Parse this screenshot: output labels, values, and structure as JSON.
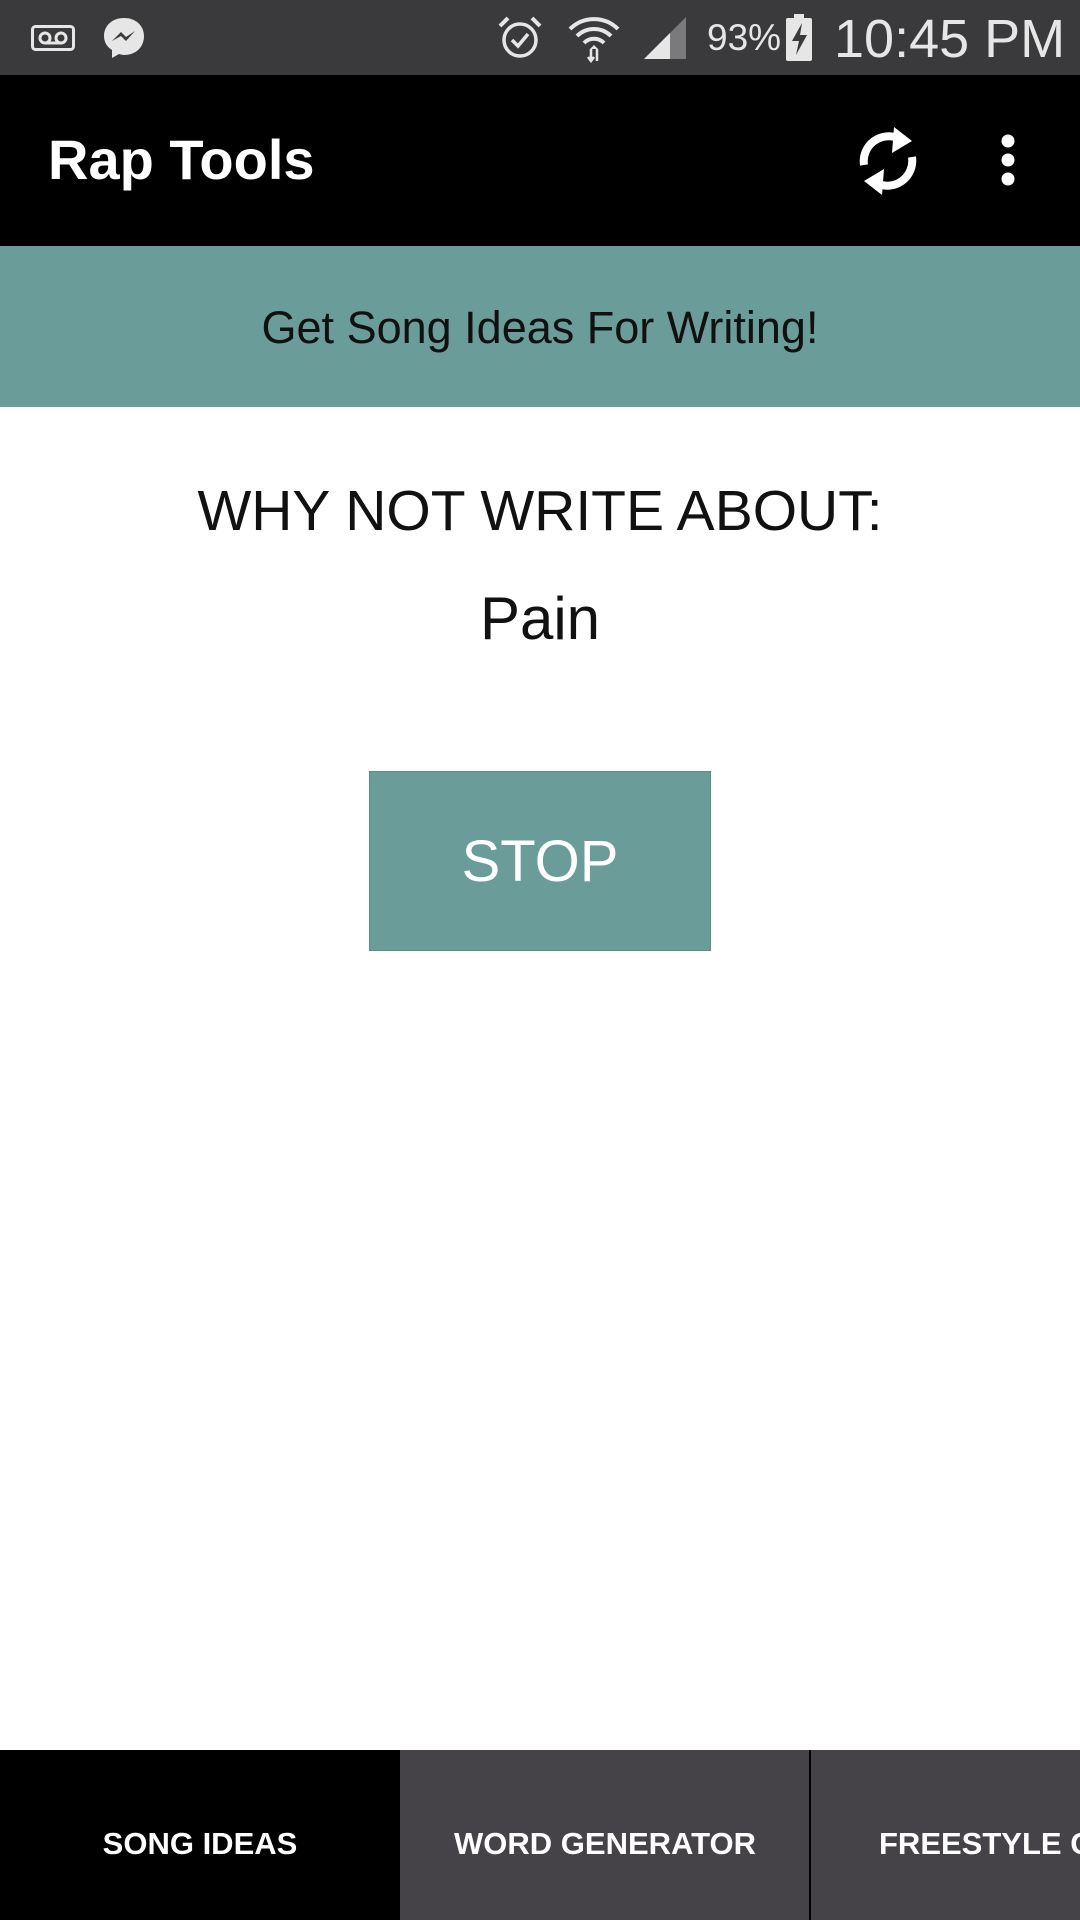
{
  "status_bar": {
    "battery_percent": "93%",
    "clock": "10:45 PM",
    "icons": [
      "voicemail-icon",
      "messenger-icon",
      "alarm-icon",
      "wifi-icon",
      "signal-icon",
      "battery-charging-icon"
    ]
  },
  "app_bar": {
    "title": "Rap Tools",
    "refresh_icon": "refresh-icon",
    "overflow_icon": "more-vertical-icon"
  },
  "banner": {
    "text": "Get Song Ideas For Writing!"
  },
  "content": {
    "heading": "WHY NOT WRITE ABOUT:",
    "idea": "Pain",
    "stop_label": "STOP"
  },
  "tabs": [
    {
      "label": "SONG IDEAS",
      "selected": true
    },
    {
      "label": "WORD GENERATOR",
      "selected": false
    },
    {
      "label": "FREESTYLE G",
      "selected": false
    }
  ],
  "colors": {
    "status_bar": "#3a393b",
    "app_bar": "#000000",
    "accent": "#6a9c99",
    "tab_bar": "#454347",
    "tab_selected": "#000000"
  }
}
